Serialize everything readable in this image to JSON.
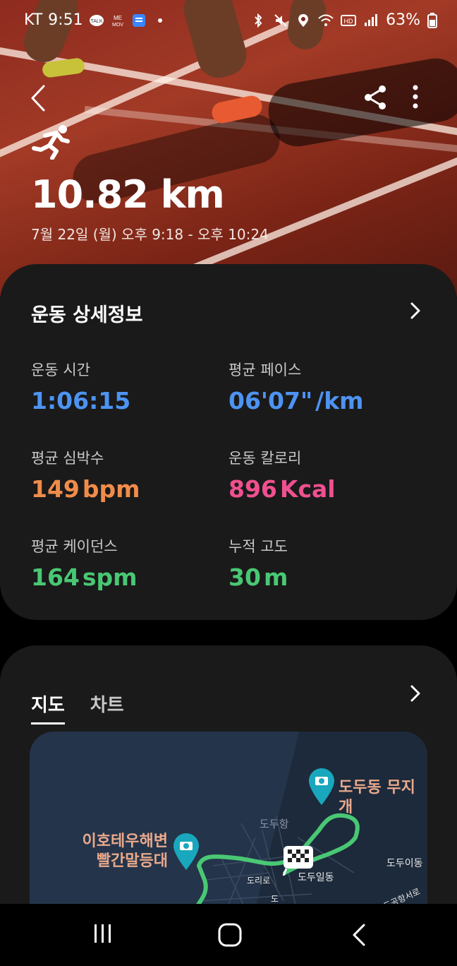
{
  "status_bar": {
    "carrier": "KT",
    "time": "9:51",
    "battery": "63%",
    "left_icons": [
      "kakaotalk-icon",
      "memov-icon",
      "app-icon",
      "dot-icon"
    ],
    "right_icons": [
      "bluetooth-icon",
      "mute-icon",
      "location-icon",
      "wifi-icon",
      "hd-icon",
      "signal-icon",
      "battery-icon"
    ]
  },
  "header": {
    "distance": "10.82 km",
    "time_range": "7월 22일 (월) 오후 9:18 - 오후 10:24",
    "activity_icon": "running-icon"
  },
  "details": {
    "title": "운동 상세정보",
    "stats": [
      {
        "label": "운동 시간",
        "value": "1:06:15",
        "unit": "",
        "color": "#4d93f2"
      },
      {
        "label": "평균 페이스",
        "value": "06'07\"",
        "unit": "/km",
        "color": "#4d93f2"
      },
      {
        "label": "평균 심박수",
        "value": "149",
        "unit": "bpm",
        "color": "#f08c4a"
      },
      {
        "label": "운동 칼로리",
        "value": "896",
        "unit": "Kcal",
        "color": "#f0508f"
      },
      {
        "label": "평균 케이던스",
        "value": "164",
        "unit": "spm",
        "color": "#49c874"
      },
      {
        "label": "누적 고도",
        "value": "30",
        "unit": "m",
        "color": "#49c874"
      }
    ]
  },
  "map_card": {
    "tabs": [
      {
        "label": "지도",
        "active": true
      },
      {
        "label": "차트",
        "active": false
      }
    ],
    "map": {
      "poi_1": "도두동 무지개",
      "poi_2_line1": "이호테우해변",
      "poi_2_line2": "빨간말등대",
      "area_1": "도두항",
      "area_2": "도두일동",
      "area_3": "도두이동",
      "road_1": "도리로",
      "road_2": "도",
      "road_3": "도공항서로"
    }
  },
  "nav": {
    "buttons": [
      "recents-button",
      "home-button",
      "back-button"
    ]
  }
}
